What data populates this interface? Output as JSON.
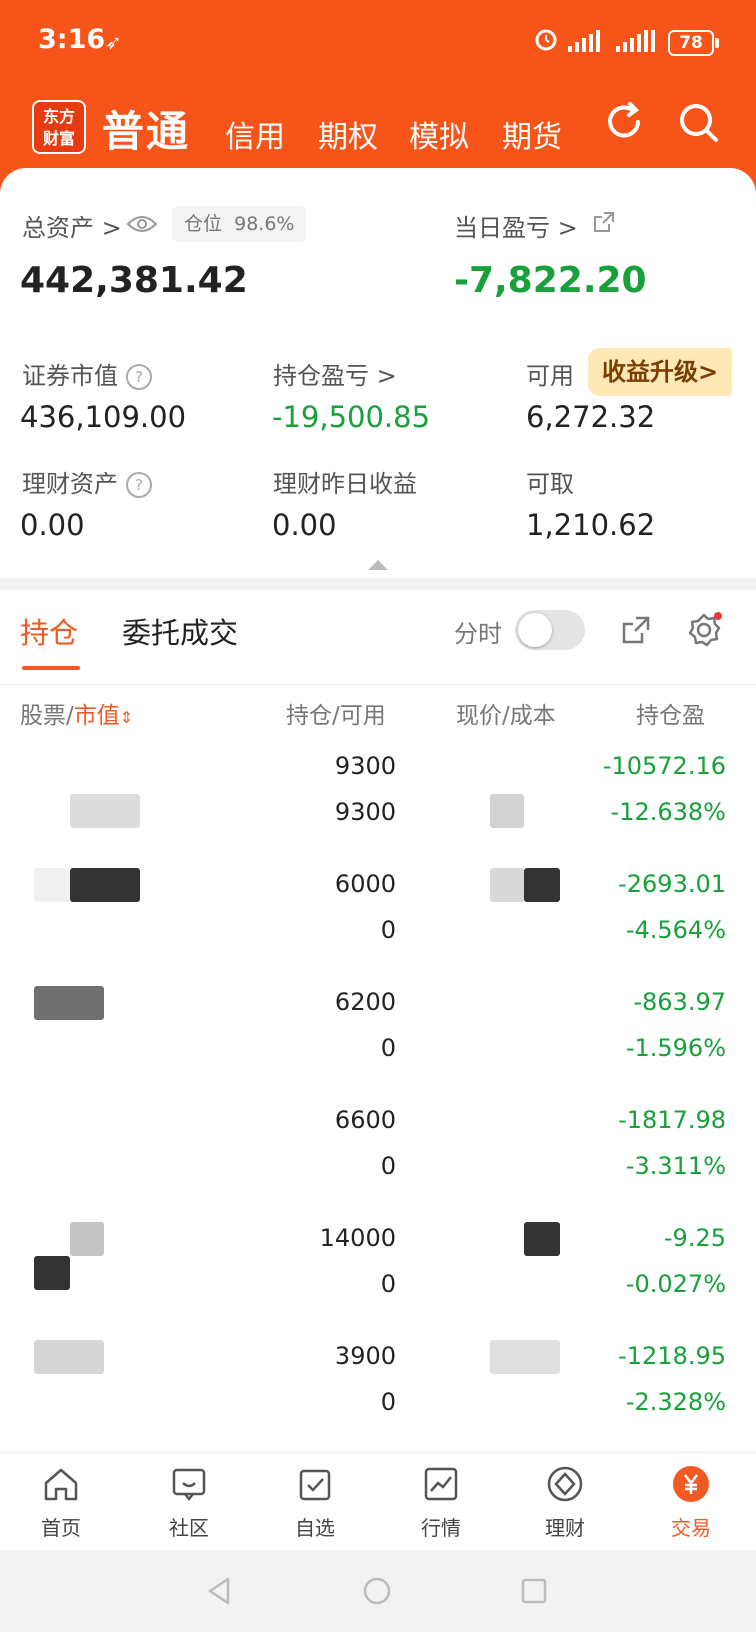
{
  "status": {
    "time": "3:16",
    "battery": "78"
  },
  "header": {
    "logo_line1": "东方",
    "logo_line2": "财富",
    "tabs": [
      "普通",
      "信用",
      "期权",
      "模拟",
      "期货"
    ]
  },
  "summary": {
    "total_assets_label": "总资产 >",
    "position_label": "仓位",
    "position_value": "98.6%",
    "total_assets": "442,381.42",
    "daily_pl_label": "当日盈亏 >",
    "daily_pl": "-7,822.20",
    "securities_value_label": "证券市值",
    "securities_value": "436,109.00",
    "holding_pl_label": "持仓盈亏 >",
    "holding_pl": "-19,500.85",
    "available_label": "可用",
    "available": "6,272.32",
    "upgrade_label": "收益升级>",
    "wealth_assets_label": "理财资产",
    "wealth_assets": "0.00",
    "wealth_yesterday_label": "理财昨日收益",
    "wealth_yesterday": "0.00",
    "withdrawable_label": "可取",
    "withdrawable": "1,210.62"
  },
  "holdings": {
    "tabs": [
      "持仓",
      "委托成交"
    ],
    "intraday_label": "分时",
    "columns": {
      "stock": "股票/",
      "market_value": "市值",
      "qty": "持仓/可用",
      "price": "现价/成本",
      "pl": "持仓盈"
    },
    "rows": [
      {
        "qty": "9300",
        "avail": "9300",
        "pl": "-10572.16",
        "pl_pct": "-12.638%"
      },
      {
        "qty": "6000",
        "avail": "0",
        "pl": "-2693.01",
        "pl_pct": "-4.564%"
      },
      {
        "qty": "6200",
        "avail": "0",
        "pl": "-863.97",
        "pl_pct": "-1.596%"
      },
      {
        "qty": "6600",
        "avail": "0",
        "pl": "-1817.98",
        "pl_pct": "-3.311%"
      },
      {
        "qty": "14000",
        "avail": "0",
        "pl": "-9.25",
        "pl_pct": "-0.027%"
      },
      {
        "qty": "3900",
        "avail": "0",
        "pl": "-1218.95",
        "pl_pct": "-2.328%"
      }
    ]
  },
  "bottom_nav": [
    {
      "label": "首页",
      "icon": "home-icon"
    },
    {
      "label": "社区",
      "icon": "chat-icon"
    },
    {
      "label": "自选",
      "icon": "checkbox-icon"
    },
    {
      "label": "行情",
      "icon": "chart-icon"
    },
    {
      "label": "理财",
      "icon": "diamond-icon"
    },
    {
      "label": "交易",
      "icon": "yen-icon"
    }
  ],
  "colors": {
    "brand": "#f7541a",
    "loss_green": "#18a03a",
    "accent": "#f15a22"
  }
}
